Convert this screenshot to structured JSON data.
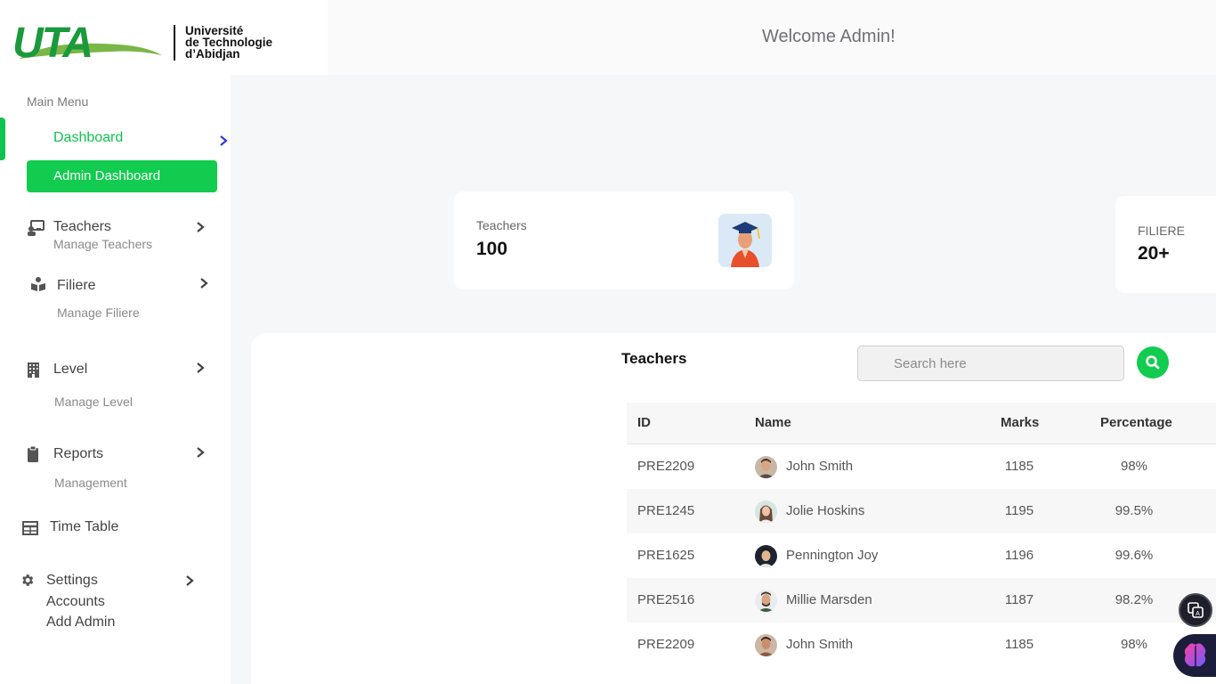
{
  "header": {
    "logo_text": "UTA",
    "logo_lines": [
      "Université",
      "de Technologie",
      "d’Abidjan"
    ],
    "welcome": "Welcome Admin!"
  },
  "sidebar": {
    "menu_title": "Main Menu",
    "dashboard_label": "Dashboard",
    "admin_dashboard_label": "Admin Dashboard",
    "items": [
      {
        "label": "Teachers",
        "sub": [
          "Manage Teachers"
        ],
        "icon": "teacher-board-icon"
      },
      {
        "label": "Filiere",
        "sub": [
          "Manage Filiere"
        ],
        "icon": "books-icon"
      },
      {
        "label": "Level",
        "sub": [
          "Manage Level"
        ],
        "icon": "building-icon"
      },
      {
        "label": "Reports",
        "sub": [
          "Management"
        ],
        "icon": "clipboard-icon"
      },
      {
        "label": "Time Table",
        "sub": [],
        "icon": "table-icon"
      },
      {
        "label": "Settings",
        "sub": [
          "Accounts",
          "Add Admin"
        ],
        "icon": "gear-icon"
      }
    ]
  },
  "stats": {
    "teachers": {
      "label": "Teachers",
      "value": "100"
    },
    "filiere": {
      "label": "FILIERE",
      "value": "20+"
    }
  },
  "teachers_table": {
    "title": "Teachers",
    "search_placeholder": "Search here",
    "columns": [
      "ID",
      "Name",
      "Marks",
      "Percentage"
    ],
    "rows": [
      {
        "id": "PRE2209",
        "name": "John Smith",
        "marks": "1185",
        "percentage": "98%"
      },
      {
        "id": "PRE1245",
        "name": "Jolie Hoskins",
        "marks": "1195",
        "percentage": "99.5%"
      },
      {
        "id": "PRE1625",
        "name": "Pennington Joy",
        "marks": "1196",
        "percentage": "99.6%"
      },
      {
        "id": "PRE2516",
        "name": "Millie Marsden",
        "marks": "1187",
        "percentage": "98.2%"
      },
      {
        "id": "PRE2209",
        "name": "John Smith",
        "marks": "1185",
        "percentage": "98%"
      }
    ]
  },
  "colors": {
    "accent": "#11cc4e",
    "logo_green": "#1a9a3c",
    "chevron_blue": "#2b3fd6"
  }
}
